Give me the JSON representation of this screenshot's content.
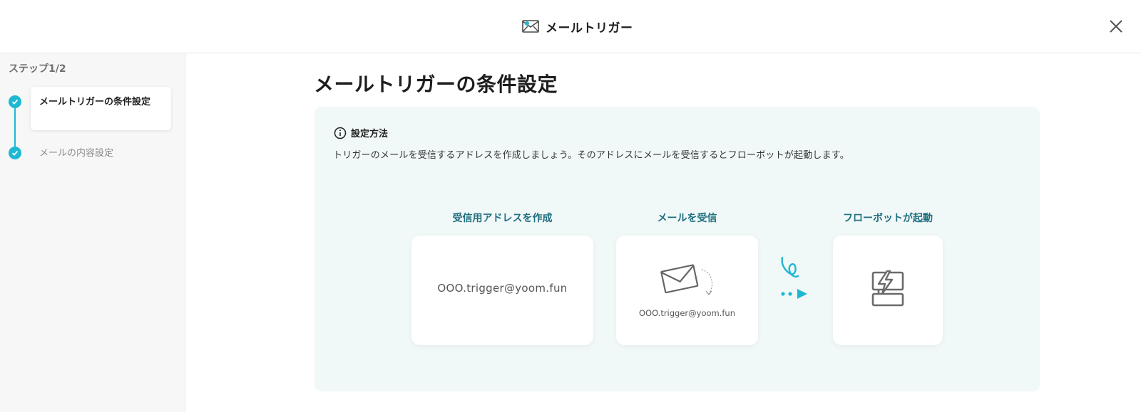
{
  "header": {
    "title": "メールトリガー"
  },
  "sidebar": {
    "step_count": "ステップ1/2",
    "steps": [
      {
        "label": "メールトリガーの条件設定"
      },
      {
        "label": "メールの内容設定"
      }
    ]
  },
  "main": {
    "title": "メールトリガーの条件設定",
    "info": {
      "heading": "設定方法",
      "description": "トリガーのメールを受信するアドレスを作成しましょう。そのアドレスにメールを受信するとフローボットが起動します。"
    },
    "flow": {
      "steps": [
        {
          "label": "受信用アドレスを作成",
          "card_text": "OOO.trigger@yoom.fun"
        },
        {
          "label": "メールを受信",
          "card_text": "OOO.trigger@yoom.fun"
        },
        {
          "label": "フローボットが起動"
        }
      ]
    }
  },
  "colors": {
    "accent": "#1eb8d2",
    "panel_bg": "#f1f8f8",
    "flow_label": "#1f6f7f"
  }
}
